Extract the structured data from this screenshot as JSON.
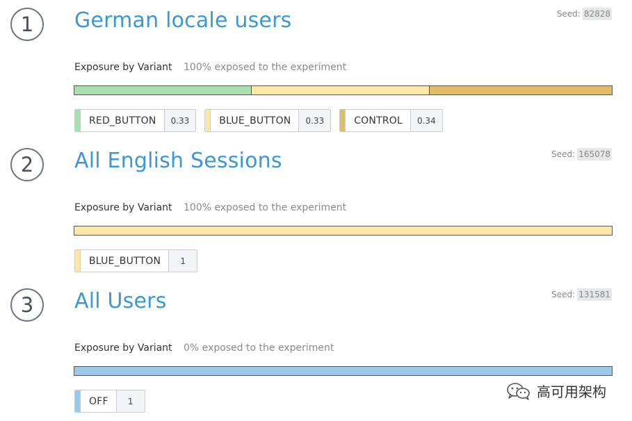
{
  "segments": [
    {
      "number": "1",
      "title": "German locale users",
      "seed_label": "Seed:",
      "seed_value": "82828",
      "exposure_label": "Exposure by Variant",
      "exposure_text": "100% exposed to the experiment",
      "variants": [
        {
          "name": "RED_BUTTON",
          "value": "0.33",
          "share": 0.33,
          "color": "#a8deb0"
        },
        {
          "name": "BLUE_BUTTON",
          "value": "0.33",
          "share": 0.33,
          "color": "#fde8a8"
        },
        {
          "name": "CONTROL",
          "value": "0.34",
          "share": 0.34,
          "color": "#dfbd66"
        }
      ]
    },
    {
      "number": "2",
      "title": "All English Sessions",
      "seed_label": "Seed:",
      "seed_value": "165078",
      "exposure_label": "Exposure by Variant",
      "exposure_text": "100% exposed to the experiment",
      "variants": [
        {
          "name": "BLUE_BUTTON",
          "value": "1",
          "share": 1,
          "color": "#fde8a8"
        }
      ]
    },
    {
      "number": "3",
      "title": "All Users",
      "seed_label": "Seed:",
      "seed_value": "131581",
      "exposure_label": "Exposure by Variant",
      "exposure_text": "0% exposed to the experiment",
      "variants": [
        {
          "name": "OFF",
          "value": "1",
          "share": 1,
          "color": "#9cc8e8"
        }
      ]
    }
  ],
  "watermark": {
    "icon": "wechat-icon",
    "text": "高可用架构"
  }
}
